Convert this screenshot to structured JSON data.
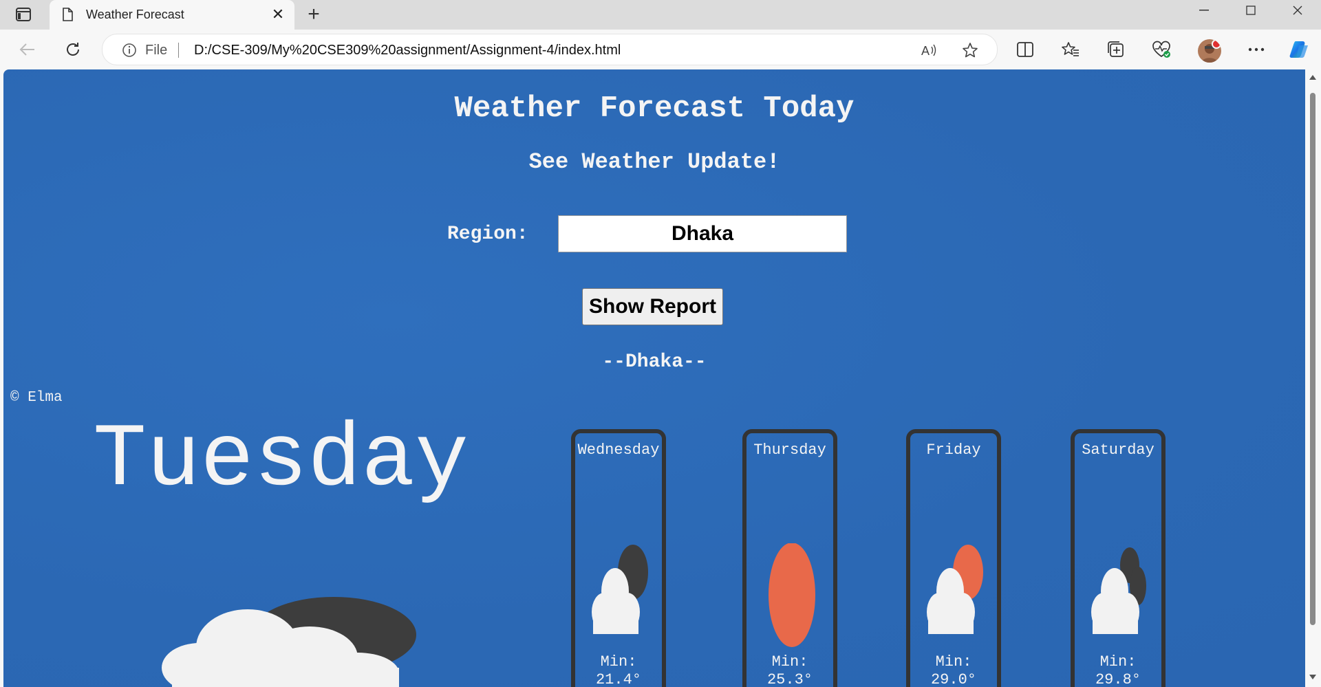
{
  "browser": {
    "tab_title": "Weather Forecast",
    "omnibox_file_label": "File",
    "url": "D:/CSE-309/My%20CSE309%20assignment/Assignment-4/index.html"
  },
  "page": {
    "title": "Weather Forecast Today",
    "subtitle": "See Weather Update!",
    "region_label": "Region:",
    "region_value": "Dhaka",
    "show_button": "Show Report",
    "city_heading": "--Dhaka--",
    "credit": "© Elma",
    "today": {
      "day": "Tuesday",
      "icon": "cloudy-night-icon"
    },
    "forecast": [
      {
        "day": "Wednesday",
        "min_label": "Min:",
        "min": "21.4°",
        "icon": "cloudy-night-icon"
      },
      {
        "day": "Thursday",
        "min_label": "Min:",
        "min": "25.3°",
        "icon": "sun-icon"
      },
      {
        "day": "Friday",
        "min_label": "Min:",
        "min": "29.0°",
        "icon": "partly-sunny-icon"
      },
      {
        "day": "Saturday",
        "min_label": "Min:",
        "min": "29.8°",
        "icon": "cloudy-night-icon"
      }
    ]
  },
  "colors": {
    "page_background": "#2e6bb8",
    "text": "#f4f4f4",
    "card_border": "#333333",
    "sun": "#e8694a",
    "moon": "#3d3d3d"
  }
}
